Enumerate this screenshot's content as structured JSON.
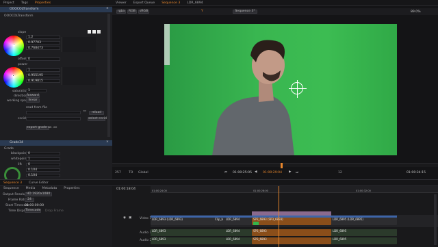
{
  "left_tabs": [
    "Project",
    "Tags",
    "Properties"
  ],
  "left_active_tab": "Properties",
  "node1": {
    "title": "OOOCOLTransform",
    "subtitle": "OOOCOLTransform",
    "slope_label": "slope",
    "slope_values": [
      "1.2",
      "0.97703",
      "0.768473"
    ],
    "offset_label": "offset",
    "offset_value": "0",
    "power_label": "power",
    "power_values": [
      "1",
      "0.955195",
      "0.919815"
    ],
    "saturation_label": "saturation",
    "saturation_value": "1",
    "direction_label": "direction",
    "direction_value": "forward",
    "working_space_label": "working space",
    "working_space_value": "linear",
    "read_from_file_label": "read from file",
    "reload_label": "reload",
    "cccid_label": "cccid",
    "select_cccid_label": "select cccid",
    "export_label": "export grade as .cc"
  },
  "node2": {
    "title": "Grade34",
    "subtitle": "Grade",
    "blackpoint_label": "blackpoint",
    "blackpoint_value": "0",
    "whitepoint_label": "whitepoint",
    "whitepoint_value": "1",
    "lift_label": "lift",
    "lift_value": "0",
    "lift_values": [
      "0.104",
      "0.104"
    ]
  },
  "viewer": {
    "tabs": [
      "Viewer",
      "Export Queue",
      "Sequence 3",
      "LDR_6894"
    ],
    "active_tab": "Sequence 3",
    "toolbar": [
      "rgba",
      "RGB",
      "sRGB",
      "Sequence 3*"
    ],
    "zoom": "89.0%",
    "channel_label": "Y"
  },
  "transport": {
    "start_frame": "257",
    "mode": "TO",
    "space": "Global",
    "timecode_in": "01:00:25:05",
    "timecode_current": "01:00:29:04",
    "timecode_out": "01:00:34:15",
    "fps": "12"
  },
  "seq_tabs": [
    "Sequence 3",
    "Curve Editor"
  ],
  "seq_active_tab": "Sequence 3",
  "props_tabs": [
    "Sequence",
    "Media",
    "Metadata",
    "Properties"
  ],
  "seq_props": {
    "output_resolution_label": "Output Resolution",
    "output_resolution_value": "HD 1920x1080",
    "frame_rate_label": "Frame Rate",
    "frame_rate_value": "24",
    "start_timecode_label": "Start Timecode",
    "start_timecode_value": "01:00:00:00",
    "time_display_label": "Time Display",
    "time_display_value": "Timecode",
    "drop_frame_label": "Drop Frame"
  },
  "timeline": {
    "timecode": "01:00:18:04",
    "ruler": [
      "01:00:24:00",
      "01:00:28:00",
      "01:00:32:00"
    ],
    "video_track": "Video 1",
    "audio_tracks": [
      "Audio 1",
      "Audio 2"
    ],
    "video_clips": [
      "LDR_6893 (LDR_6893)",
      "Clip_b",
      "LDR_6894",
      "SP3_6893 (SP3_6893)",
      "LDR_6895 (LDR_6895)"
    ],
    "audio1_clips": [
      "LDR_6893",
      "LDR_6894",
      "SP3_6893",
      "LDR_6895"
    ],
    "audio2_clips": [
      "LDR_6893",
      "LDR_6894",
      "SP3_6893",
      "LDR_6895"
    ]
  },
  "colors": {
    "accent": "#e8862c",
    "green_screen": "#35b54b",
    "clip_orange": "#8a4e1a",
    "clip_blue": "#3d65a8"
  }
}
